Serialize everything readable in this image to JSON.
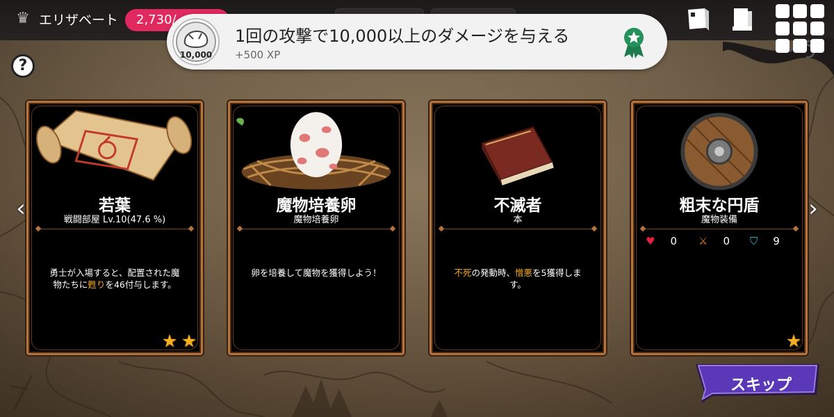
{
  "topbar": {
    "player_name": "エリザベート",
    "gems": "2,730/",
    "icons": [
      "crown-icon",
      "book-icon",
      "journal-icon",
      "menu-grid-icon"
    ]
  },
  "toast": {
    "title": "1回の攻撃で10,000以上のダメージを与える",
    "xp": "+500 XP",
    "badge_label": "10,000"
  },
  "help_label": "?",
  "cards": [
    {
      "title": "若葉",
      "subtitle": "戦闘部屋 Lv.10(47.6 %)",
      "desc_pre": "勇士が入場すると、配置された魔物たちに",
      "desc_hl": "甦り",
      "desc_post": "を46付与します。",
      "stars": 2,
      "icon": "scroll-icon"
    },
    {
      "title": "魔物培養卵",
      "subtitle": "魔物培養卵",
      "desc": "卵を培養して魔物を獲得しよう！",
      "stars": 0,
      "icon": "egg-nest-icon"
    },
    {
      "title": "不滅者",
      "subtitle": "本",
      "desc_hl1": "不死",
      "desc_mid": "の発動時、",
      "desc_hl2": "憎悪",
      "desc_post": "を5獲得します。",
      "stars": 0,
      "icon": "book-icon"
    },
    {
      "title": "粗末な円盾",
      "subtitle": "魔物装備",
      "stats": {
        "hp": "0",
        "atk": "0",
        "def": "9"
      },
      "stars": 1,
      "icon": "shield-icon"
    }
  ],
  "nav": {
    "prev": "‹",
    "next": "›"
  },
  "skip_label": "スキップ",
  "colors": {
    "highlight": "#f2a81e",
    "gem_pill": "#e0295f",
    "skip": "#5b38b8",
    "card_border": "#b47440"
  }
}
